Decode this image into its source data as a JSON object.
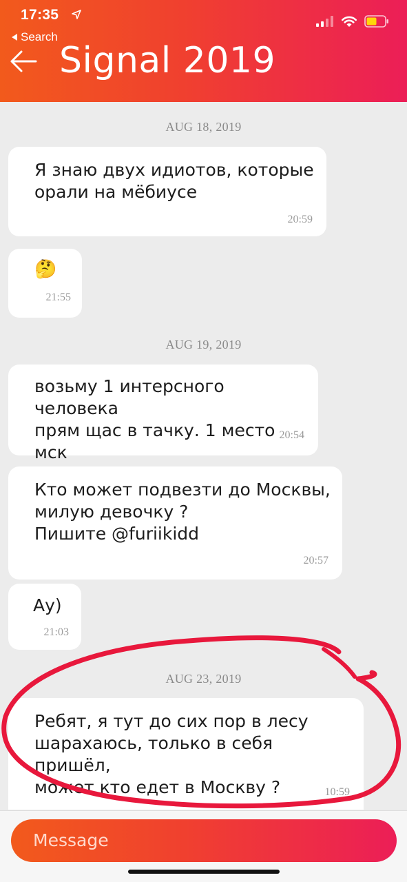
{
  "status_bar": {
    "time": "17:35",
    "back_label": "Search"
  },
  "header": {
    "title": "Signal 2019"
  },
  "conversation": [
    {
      "date": "AUG 18, 2019"
    },
    {
      "text": "Я знаю двух идиотов, которые\nорали на мёбиусе",
      "time": "20:59"
    },
    {
      "text": "🤔",
      "time": "21:55"
    },
    {
      "date": "AUG 19, 2019"
    },
    {
      "text": "возьму 1 интерсного человека\nпрям щас в тачку. 1 место мск",
      "time": "20:54"
    },
    {
      "text": "Кто может подвезти до Москвы,\nмилую девочку ?\nПишите @furiikidd",
      "time": "20:57"
    },
    {
      "text": "Ау)",
      "time": "21:03"
    },
    {
      "date": "AUG 23, 2019"
    },
    {
      "text": "Ребят, я тут до сих пор в лесу\nшарахаюсь, только в себя пришёл,\nможет кто едет в Москву ?",
      "time": "10:59"
    }
  ],
  "composer": {
    "placeholder": "Message"
  },
  "colors": {
    "accent_start": "#f25a1c",
    "accent_end": "#ec1e57",
    "annotation": "#e8183c",
    "battery": "#ffd60a"
  },
  "icons": [
    "location-arrow-icon",
    "back-chevron-icon",
    "signal-bars-icon",
    "wifi-icon",
    "battery-icon",
    "back-arrow-icon"
  ]
}
